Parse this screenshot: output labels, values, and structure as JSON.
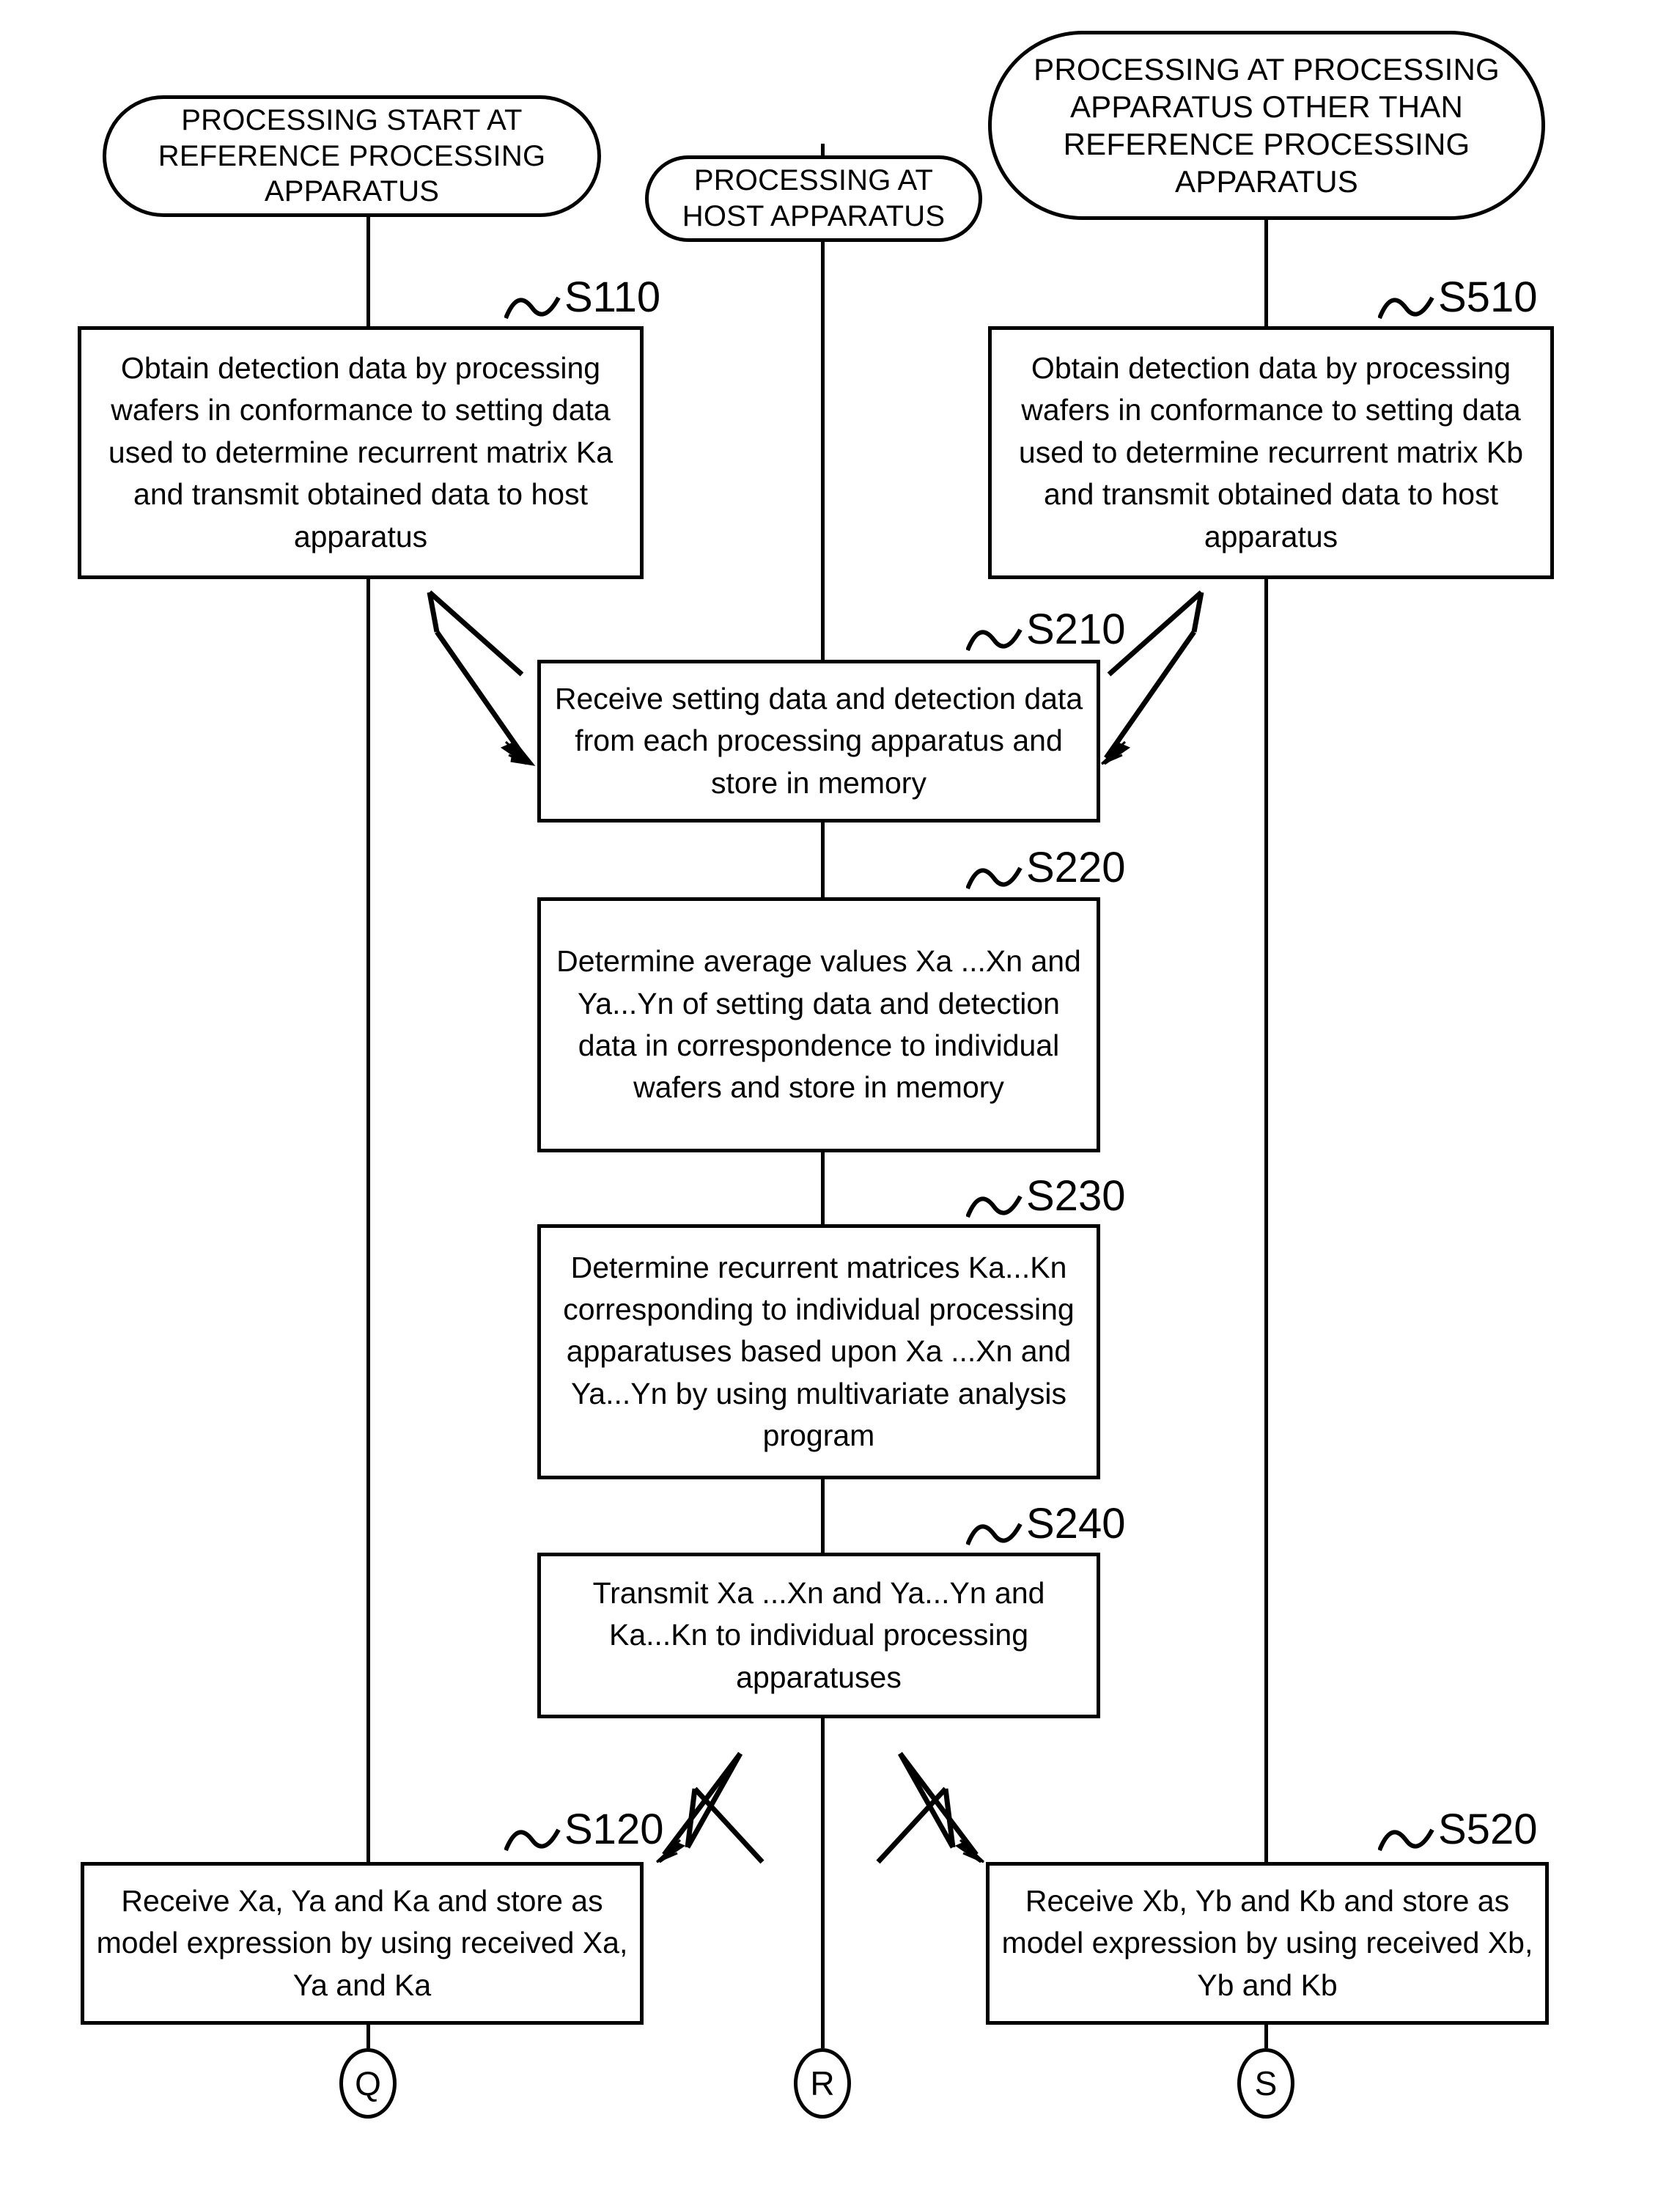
{
  "diagram": {
    "type": "flowchart",
    "title": "",
    "lanes": [
      {
        "id": "reference-processing-apparatus",
        "label": "PROCESSING START AT REFERENCE PROCESSING APPARATUS"
      },
      {
        "id": "host-apparatus",
        "label": "PROCESSING AT HOST APPARATUS"
      },
      {
        "id": "other-processing-apparatus",
        "label": "PROCESSING AT PROCESSING APPARATUS OTHER THAN REFERENCE PROCESSING APPARATUS"
      }
    ],
    "terminators": [
      {
        "id": "term-left",
        "text": "PROCESSING START AT REFERENCE PROCESSING APPARATUS"
      },
      {
        "id": "term-center",
        "text": "PROCESSING AT HOST APPARATUS"
      },
      {
        "id": "term-right",
        "text": "PROCESSING AT PROCESSING APPARATUS OTHER THAN REFERENCE PROCESSING APPARATUS"
      }
    ],
    "steps": [
      {
        "id": "S110",
        "label": "S110",
        "lane": "reference-processing-apparatus",
        "text": "Obtain detection data by processing wafers in conformance to setting data used to determine recurrent matrix Ka and transmit obtained data to host apparatus"
      },
      {
        "id": "S510",
        "label": "S510",
        "lane": "other-processing-apparatus",
        "text": "Obtain detection data by processing wafers in conformance to setting data used to determine recurrent matrix Kb and transmit obtained data to host apparatus"
      },
      {
        "id": "S210",
        "label": "S210",
        "lane": "host-apparatus",
        "text": "Receive setting data and detection data from each processing apparatus and store in memory"
      },
      {
        "id": "S220",
        "label": "S220",
        "lane": "host-apparatus",
        "text": "Determine average values Xa ...Xn and Ya...Yn of setting data and detection data in correspondence to individual wafers and store in memory"
      },
      {
        "id": "S230",
        "label": "S230",
        "lane": "host-apparatus",
        "text": "Determine recurrent matrices Ka...Kn corresponding to individual processing apparatuses based upon Xa ...Xn and Ya...Yn by using multivariate analysis program"
      },
      {
        "id": "S240",
        "label": "S240",
        "lane": "host-apparatus",
        "text": "Transmit Xa ...Xn and Ya...Yn and Ka...Kn to individual processing apparatuses"
      },
      {
        "id": "S120",
        "label": "S120",
        "lane": "reference-processing-apparatus",
        "text": "Receive Xa, Ya and Ka and store as model expression by using received Xa, Ya and Ka"
      },
      {
        "id": "S520",
        "label": "S520",
        "lane": "other-processing-apparatus",
        "text": "Receive Xb, Yb and Kb and store as model expression by using received Xb, Yb and Kb"
      }
    ],
    "connectors": [
      {
        "id": "conn-q",
        "label": "Q",
        "lane": "reference-processing-apparatus"
      },
      {
        "id": "conn-r",
        "label": "R",
        "lane": "host-apparatus"
      },
      {
        "id": "conn-s",
        "label": "S",
        "lane": "other-processing-apparatus"
      }
    ],
    "flows": [
      {
        "from": "S110",
        "to": "S210"
      },
      {
        "from": "S510",
        "to": "S210"
      },
      {
        "from": "S210",
        "to": "S220"
      },
      {
        "from": "S220",
        "to": "S230"
      },
      {
        "from": "S230",
        "to": "S240"
      },
      {
        "from": "S240",
        "to": "S120"
      },
      {
        "from": "S240",
        "to": "S520"
      },
      {
        "from": "S120",
        "to": "conn-q"
      },
      {
        "from": "S240",
        "to": "conn-r"
      },
      {
        "from": "S520",
        "to": "conn-s"
      }
    ],
    "colors": {
      "line": "#000000",
      "background": "#ffffff",
      "text": "#000000"
    }
  }
}
